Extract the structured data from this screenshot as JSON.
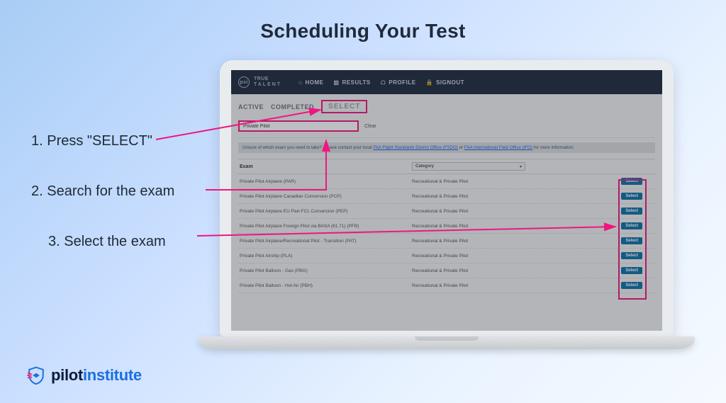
{
  "title": "Scheduling Your Test",
  "steps": {
    "s1": "1. Press \"SELECT\"",
    "s2": "2. Search for the exam",
    "s3": "3. Select the exam"
  },
  "brand": {
    "badge": "psi",
    "line1": "TRUE",
    "line2": "TALENT"
  },
  "nav": {
    "home": "HOME",
    "results": "RESULTS",
    "profile": "PROFILE",
    "signout": "SIGNOUT"
  },
  "tabs": {
    "active": "ACTIVE",
    "completed": "COMPLETED",
    "select": "SELECT"
  },
  "search": {
    "value": "Private Pilot",
    "clear": "Clear"
  },
  "notice": {
    "pre": "Unsure of which exam you need to take? Please contact your local ",
    "link1": "FAA Flight Standards District Office (FSDO)",
    "mid": " or ",
    "link2": "FAA International Field Office (IFO)",
    "post": " for more information."
  },
  "table": {
    "header_exam": "Exam",
    "header_category": "Category",
    "select_label": "Select",
    "rows": [
      {
        "exam": "Private Pilot Airplane (PAR)",
        "cat": "Recreational & Private Pilot"
      },
      {
        "exam": "Private Pilot Airplane Canadian Conversion (PCP)",
        "cat": "Recreational & Private Pilot"
      },
      {
        "exam": "Private Pilot Airplane EU Part-FCL Conversion (PEP)",
        "cat": "Recreational & Private Pilot"
      },
      {
        "exam": "Private Pilot Airplane Foreign Pilot via BASA (61.71) (PFB)",
        "cat": "Recreational & Private Pilot"
      },
      {
        "exam": "Private Pilot Airplane/Recreational Pilot - Transition (PAT)",
        "cat": "Recreational & Private Pilot"
      },
      {
        "exam": "Private Pilot Airship (PLA)",
        "cat": "Recreational & Private Pilot"
      },
      {
        "exam": "Private Pilot Balloon - Gas (PBG)",
        "cat": "Recreational & Private Pilot"
      },
      {
        "exam": "Private Pilot Balloon - Hot Air (PBH)",
        "cat": "Recreational & Private Pilot"
      }
    ]
  },
  "logo": {
    "word1": "pilot",
    "word2": "institute"
  }
}
